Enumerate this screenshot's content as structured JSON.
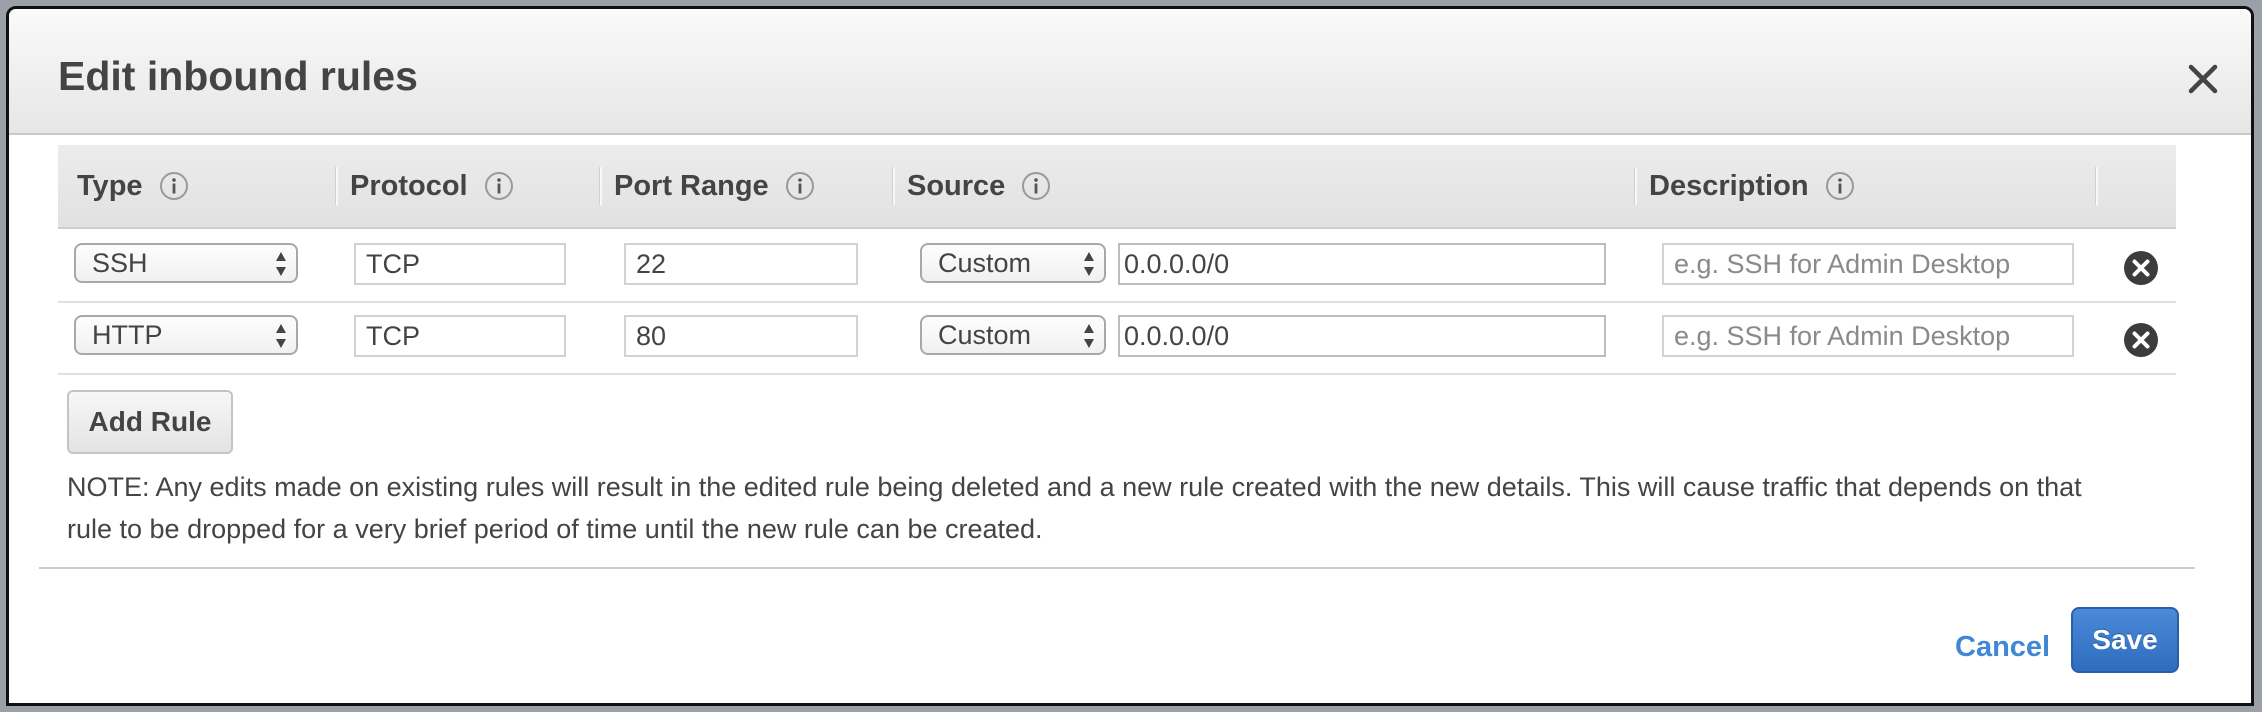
{
  "dialog": {
    "title": "Edit inbound rules",
    "close_icon": "close-icon"
  },
  "table": {
    "columns": [
      {
        "label": "Type",
        "icon": "info-icon"
      },
      {
        "label": "Protocol",
        "icon": "info-icon"
      },
      {
        "label": "Port Range",
        "icon": "info-icon"
      },
      {
        "label": "Source",
        "icon": "info-icon"
      },
      {
        "label": "Description",
        "icon": "info-icon"
      }
    ],
    "rows": [
      {
        "type": "SSH",
        "protocol": "TCP",
        "port_range": "22",
        "source_mode": "Custom",
        "source_value": "0.0.0.0/0",
        "description_value": "",
        "description_placeholder": "e.g. SSH for Admin Desktop",
        "remove_icon": "remove-circle-icon"
      },
      {
        "type": "HTTP",
        "protocol": "TCP",
        "port_range": "80",
        "source_mode": "Custom",
        "source_value": "0.0.0.0/0",
        "description_value": "",
        "description_placeholder": "e.g. SSH for Admin Desktop",
        "remove_icon": "remove-circle-icon"
      }
    ]
  },
  "actions": {
    "add_rule_label": "Add Rule",
    "note": "NOTE: Any edits made on existing rules will result in the edited rule being deleted and a new rule created with the new details. This will cause traffic that depends on that rule to be dropped for a very brief period of time until the new rule can be created.",
    "cancel_label": "Cancel",
    "save_label": "Save"
  },
  "colors": {
    "primary": "#3a7bd0",
    "link": "#3f88d8",
    "remove_icon": "#3c3c3c"
  }
}
